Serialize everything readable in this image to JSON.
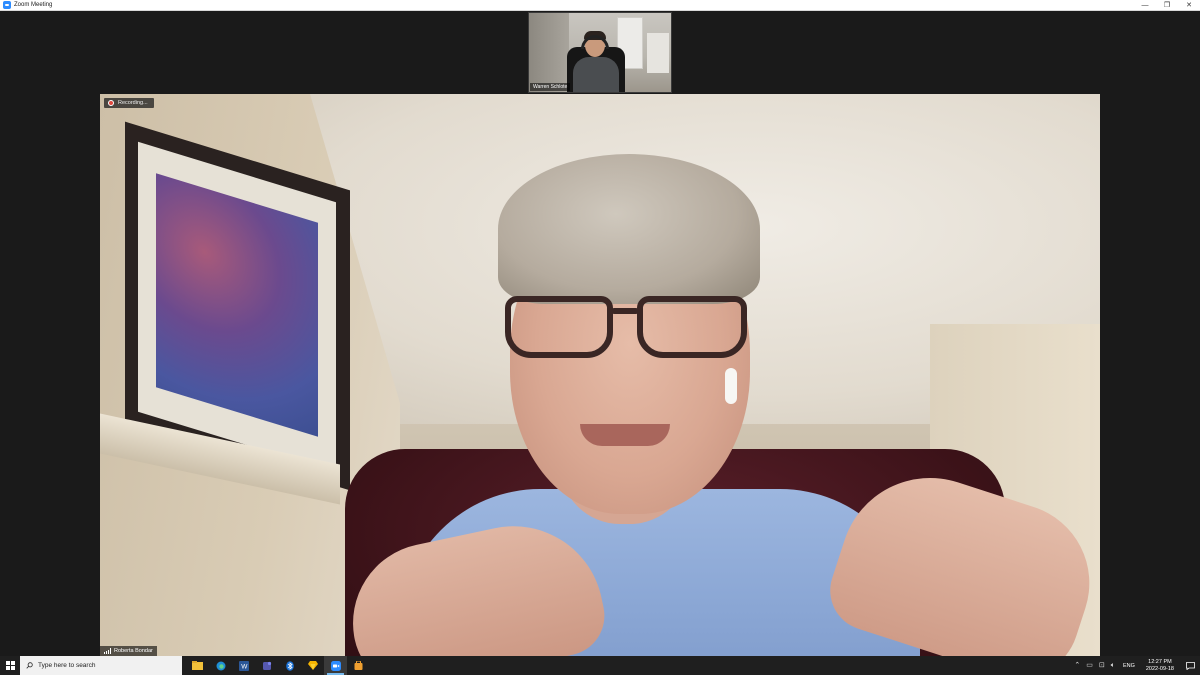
{
  "window": {
    "title": "Zoom Meeting",
    "controls": {
      "minimize": "—",
      "restore": "❐",
      "close": "✕"
    }
  },
  "meeting": {
    "thumbnail_participant": "Warren Schlote",
    "recording_label": "Recording...",
    "speaker_name": "Roberta Bondar"
  },
  "taskbar": {
    "search_placeholder": "Type here to search",
    "apps": [
      "file-explorer-icon",
      "edge-icon",
      "word-icon",
      "teams-icon",
      "bluetooth-icon",
      "sketch-icon",
      "zoom-icon",
      "app-icon"
    ],
    "language": "ENG",
    "time": "12:27 PM",
    "date": "2022-09-18"
  },
  "colors": {
    "zoom_blue": "#2d8cff",
    "recording_red": "#e0483e",
    "taskbar": "#1f1f1f",
    "meeting_bg": "#1a1a1a"
  }
}
